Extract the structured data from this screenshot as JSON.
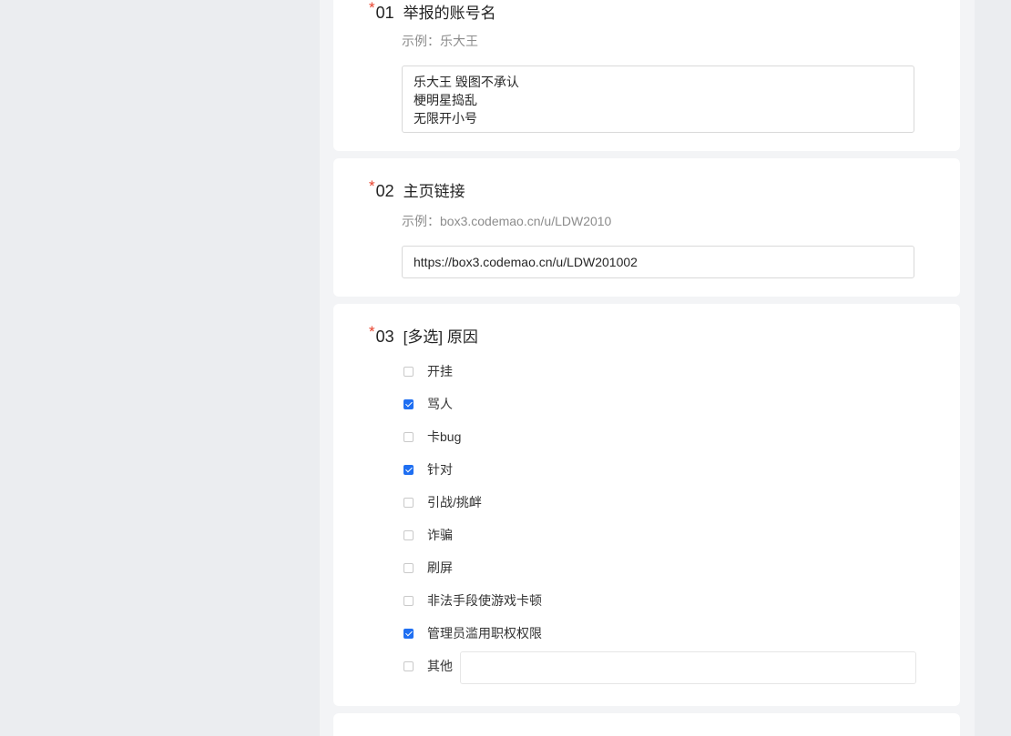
{
  "questions": [
    {
      "number": "01",
      "title": "举报的账号名",
      "hint": "示例：乐大王",
      "value_lines": [
        "乐大王 毁图不承认",
        "梗明星捣乱",
        "无限开小号"
      ]
    },
    {
      "number": "02",
      "title": "主页链接",
      "hint": "示例：box3.codemao.cn/u/LDW2010",
      "value": "https://box3.codemao.cn/u/LDW201002"
    },
    {
      "number": "03",
      "title": "[多选] 原因",
      "options": [
        {
          "label": "开挂",
          "checked": false
        },
        {
          "label": "骂人",
          "checked": true
        },
        {
          "label": "卡bug",
          "checked": false
        },
        {
          "label": "针对",
          "checked": true
        },
        {
          "label": "引战/挑衅",
          "checked": false
        },
        {
          "label": "诈骗",
          "checked": false
        },
        {
          "label": "刷屏",
          "checked": false
        },
        {
          "label": "非法手段使游戏卡顿",
          "checked": false
        },
        {
          "label": "管理员滥用职权权限",
          "checked": true
        },
        {
          "label": "其他",
          "checked": false
        }
      ],
      "other_value": ""
    }
  ],
  "required_mark": "*",
  "colors": {
    "accent": "#1f6ff2",
    "required": "#e8412c",
    "page_bg": "#ebedf0",
    "card_bg": "#ffffff"
  }
}
